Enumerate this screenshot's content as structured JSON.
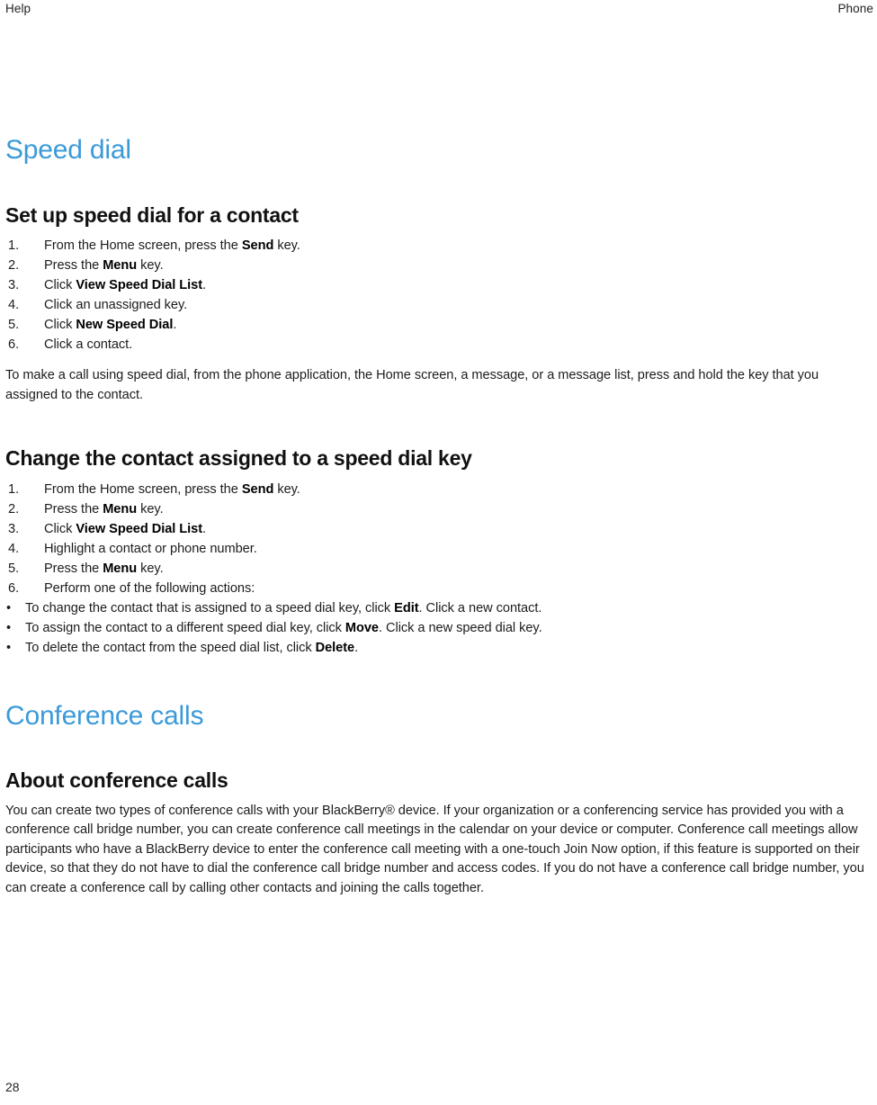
{
  "running_head": {
    "left": "Help",
    "right": "Phone"
  },
  "page_number": "28",
  "colors": {
    "chapter_heading": "#3b9ad8",
    "body_text": "#1c1c1c",
    "page_background": "#ffffff"
  },
  "sections": [
    {
      "chapter_title": "Speed dial",
      "topics": [
        {
          "heading": "Set up speed dial for a contact",
          "steps": [
            {
              "num": "1.",
              "parts": [
                {
                  "text": "From the Home screen, press the ",
                  "bold": false
                },
                {
                  "text": "Send",
                  "bold": true
                },
                {
                  "text": " key.",
                  "bold": false
                }
              ]
            },
            {
              "num": "2.",
              "parts": [
                {
                  "text": "Press the ",
                  "bold": false
                },
                {
                  "text": "Menu",
                  "bold": true
                },
                {
                  "text": " key.",
                  "bold": false
                }
              ]
            },
            {
              "num": "3.",
              "parts": [
                {
                  "text": "Click ",
                  "bold": false
                },
                {
                  "text": "View Speed Dial List",
                  "bold": true
                },
                {
                  "text": ".",
                  "bold": false
                }
              ]
            },
            {
              "num": "4.",
              "parts": [
                {
                  "text": "Click an unassigned key.",
                  "bold": false
                }
              ]
            },
            {
              "num": "5.",
              "parts": [
                {
                  "text": "Click ",
                  "bold": false
                },
                {
                  "text": "New Speed Dial",
                  "bold": true
                },
                {
                  "text": ".",
                  "bold": false
                }
              ]
            },
            {
              "num": "6.",
              "parts": [
                {
                  "text": "Click a contact.",
                  "bold": false
                }
              ]
            }
          ],
          "paragraph": "To make a call using speed dial, from the phone application, the Home screen, a message, or a message list, press and hold the key that you assigned to the contact."
        },
        {
          "heading": "Change the contact assigned to a speed dial key",
          "steps": [
            {
              "num": "1.",
              "parts": [
                {
                  "text": "From the Home screen, press the ",
                  "bold": false
                },
                {
                  "text": "Send",
                  "bold": true
                },
                {
                  "text": " key.",
                  "bold": false
                }
              ]
            },
            {
              "num": "2.",
              "parts": [
                {
                  "text": "Press the ",
                  "bold": false
                },
                {
                  "text": "Menu",
                  "bold": true
                },
                {
                  "text": " key.",
                  "bold": false
                }
              ]
            },
            {
              "num": "3.",
              "parts": [
                {
                  "text": "Click ",
                  "bold": false
                },
                {
                  "text": "View Speed Dial List",
                  "bold": true
                },
                {
                  "text": ".",
                  "bold": false
                }
              ]
            },
            {
              "num": "4.",
              "parts": [
                {
                  "text": "Highlight a contact or phone number.",
                  "bold": false
                }
              ]
            },
            {
              "num": "5.",
              "parts": [
                {
                  "text": "Press the ",
                  "bold": false
                },
                {
                  "text": "Menu",
                  "bold": true
                },
                {
                  "text": " key.",
                  "bold": false
                }
              ]
            },
            {
              "num": "6.",
              "parts": [
                {
                  "text": "Perform one of the following actions:",
                  "bold": false
                }
              ]
            }
          ],
          "substeps": {
            "bullet_glyph": "•",
            "items": [
              {
                "parts": [
                  {
                    "text": "To change the contact that is assigned to a speed dial key, click ",
                    "bold": false
                  },
                  {
                    "text": "Edit",
                    "bold": true
                  },
                  {
                    "text": ". Click a new contact.",
                    "bold": false
                  }
                ]
              },
              {
                "parts": [
                  {
                    "text": "To assign the contact to a different speed dial key, click ",
                    "bold": false
                  },
                  {
                    "text": "Move",
                    "bold": true
                  },
                  {
                    "text": ". Click a new speed dial key.",
                    "bold": false
                  }
                ]
              },
              {
                "parts": [
                  {
                    "text": "To delete the contact from the speed dial list, click ",
                    "bold": false
                  },
                  {
                    "text": "Delete",
                    "bold": true
                  },
                  {
                    "text": ".",
                    "bold": false
                  }
                ]
              }
            ]
          }
        }
      ]
    },
    {
      "chapter_title": "Conference calls",
      "topics": [
        {
          "heading": "About conference calls",
          "paragraph": "You can create two types of conference calls with your BlackBerry® device. If your organization or a conferencing service has provided you with a conference call bridge number, you can create conference call meetings in the calendar on your device or computer. Conference call meetings allow participants who have a BlackBerry device to enter the conference call meeting with a one-touch Join Now option, if this feature is supported on their device, so that they do not have to dial the conference call bridge number and access codes. If you do not have a conference call bridge number, you can create a conference call by calling other contacts and joining the calls together."
        }
      ]
    }
  ]
}
